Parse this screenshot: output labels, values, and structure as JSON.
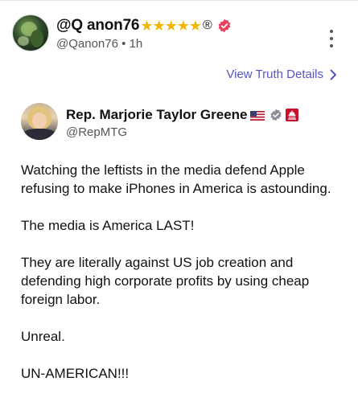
{
  "post": {
    "display_name": "@Q anon76",
    "stars": "★★★★★",
    "reg_mark": "®",
    "handle": "@Qanon76",
    "separator": "•",
    "time": "1h",
    "accent_color": "#e8425c"
  },
  "details_link": {
    "label": "View Truth Details"
  },
  "quote": {
    "name": "Rep. Marjorie Taylor Greene",
    "handle": "@RepMTG",
    "paragraphs": [
      "Watching the leftists in the media defend Apple refusing to make iPhones in America is astounding.",
      "The media is America LAST!",
      "They are literally against US job creation and defending high corporate profits by using cheap foreign labor.",
      "Unreal.",
      "UN-AMERICAN!!!"
    ]
  },
  "icons": {
    "avatar": "user-avatar-icon",
    "verified": "verified-badge-icon",
    "more": "kebab-menu-icon",
    "chevron": "chevron-right-icon",
    "flag": "us-flag-icon",
    "capitol": "capitol-badge-icon"
  },
  "colors": {
    "link": "#5454c8",
    "star": "#f2b705",
    "verified_gray": "#8e8e99",
    "capitol_red": "#c8102e"
  }
}
